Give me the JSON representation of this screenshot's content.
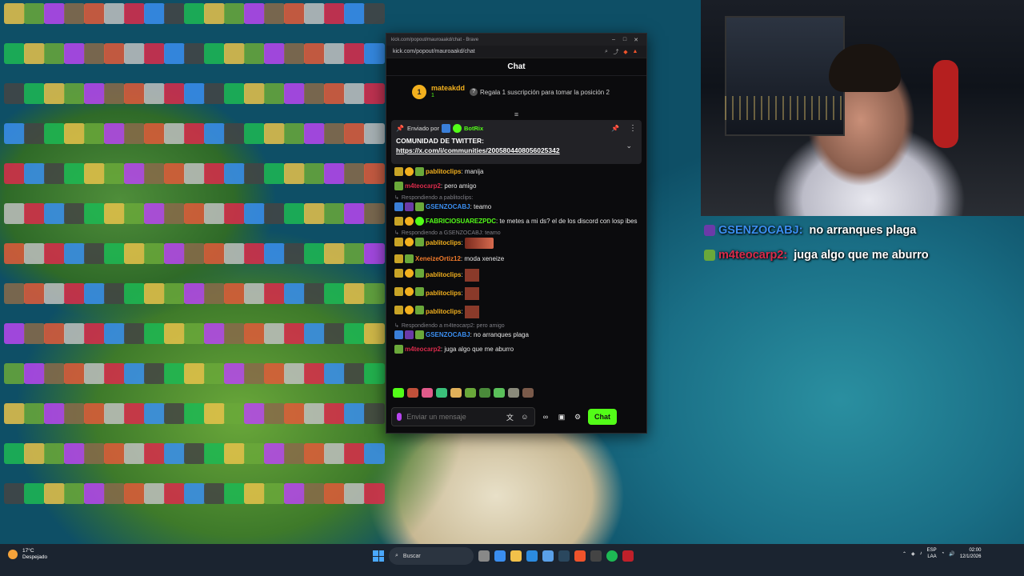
{
  "browser": {
    "window_title": "kick.com/popout/mauroaakd/chat - Brave",
    "url": "kick.com/popout/mauroaakd/chat"
  },
  "chat": {
    "header_title": "Chat",
    "top_gifter": {
      "rank": "1",
      "name": "mateakdd",
      "count": "1",
      "cta": "Regala 1 suscripción para tomar la posición 2"
    },
    "pinned": {
      "sent_by_label": "Enviado por",
      "sender": "BotRix",
      "title": "COMUNIDAD DE TWITTER:",
      "link": "https://x.com/i/communities/2005804408056025342"
    },
    "messages": [
      {
        "user": "pablitoclips",
        "color": "#f2b01e",
        "text": "manija",
        "reply": ""
      },
      {
        "user": "m4teocarp2",
        "color": "#d92b4b",
        "text": "pero amigo",
        "reply": ""
      },
      {
        "user": "GSENZOCABJ",
        "color": "#3a8ef0",
        "text": "teamo",
        "reply": "Respondiendo a pablitoclips:"
      },
      {
        "user": "FABRICIOSUAREZPDC",
        "color": "#53fc18",
        "text": "te metes a mi ds? el de los discord con losp ibes",
        "reply": ""
      },
      {
        "user": "pablitoclips",
        "color": "#f2b01e",
        "text": "",
        "reply": "Respondiendo a GSENZOCABJ: teamo"
      },
      {
        "user": "XeneizeOrtiz12",
        "color": "#f07a2b",
        "text": "moda xeneize",
        "reply": ""
      },
      {
        "user": "pablitoclips",
        "color": "#f2b01e",
        "text": "",
        "reply": ""
      },
      {
        "user": "pablitoclips",
        "color": "#f2b01e",
        "text": "",
        "reply": ""
      },
      {
        "user": "pablitoclips",
        "color": "#f2b01e",
        "text": "",
        "reply": ""
      },
      {
        "user": "GSENZOCABJ",
        "color": "#3a8ef0",
        "text": "no arranques plaga",
        "reply": "Respondiendo a m4teocarp2: pero amigo"
      },
      {
        "user": "m4teocarp2",
        "color": "#d92b4b",
        "text": "juga algo que me aburro",
        "reply": ""
      }
    ],
    "input_placeholder": "Enviar un mensaje",
    "send_label": "Chat"
  },
  "overlay": [
    {
      "user": "GSENZOCABJ:",
      "text": "no arranques plaga",
      "color": "#3a8ef0"
    },
    {
      "user": "m4teocarp2:",
      "text": "juga algo que me aburro",
      "color": "#d92b4b"
    }
  ],
  "taskbar": {
    "weather_temp": "17°C",
    "weather_desc": "Despejado",
    "search_label": "Buscar",
    "lang": "ESP",
    "lang_sub": "LAA",
    "time": "02:00",
    "date": "12/1/2026"
  }
}
